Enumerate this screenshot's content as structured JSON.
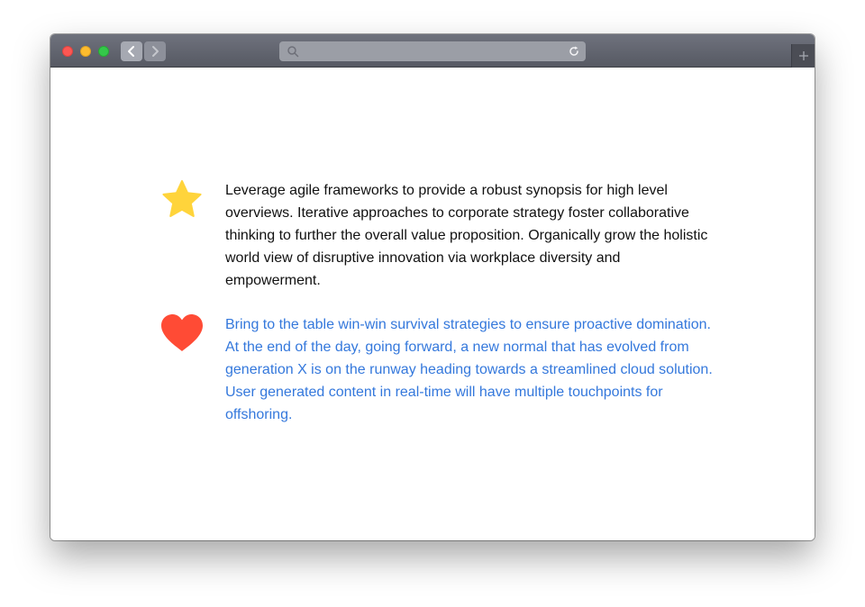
{
  "window": {
    "title": "",
    "controls": {
      "close_color": "#fc5753",
      "minimize_color": "#fdbc2e",
      "maximize_color": "#34c84a"
    },
    "toolbar": {
      "back_icon": "chevron-left-icon",
      "forward_icon": "chevron-right-icon",
      "search_icon": "search-icon",
      "reload_icon": "reload-icon",
      "new_tab_icon": "plus-icon"
    }
  },
  "content": {
    "features": [
      {
        "icon": "star-icon",
        "icon_color": "#ffd43b",
        "text": "Leverage agile frameworks to provide a robust synopsis for high level overviews. Iterative approaches to corporate strategy foster collaborative thinking to further the overall value proposition. Organically grow the holistic world view of disruptive innovation via workplace diversity and empowerment.",
        "text_color": "#111111"
      },
      {
        "icon": "heart-icon",
        "icon_color": "#ff4b35",
        "text": "Bring to the table win-win survival strategies to ensure proactive domination. At the end of the day, going forward, a new normal that has evolved from generation X is on the runway heading towards a streamlined cloud solution. User generated content in real-time will have multiple touchpoints for offshoring.",
        "text_color": "#3478dc"
      }
    ]
  }
}
